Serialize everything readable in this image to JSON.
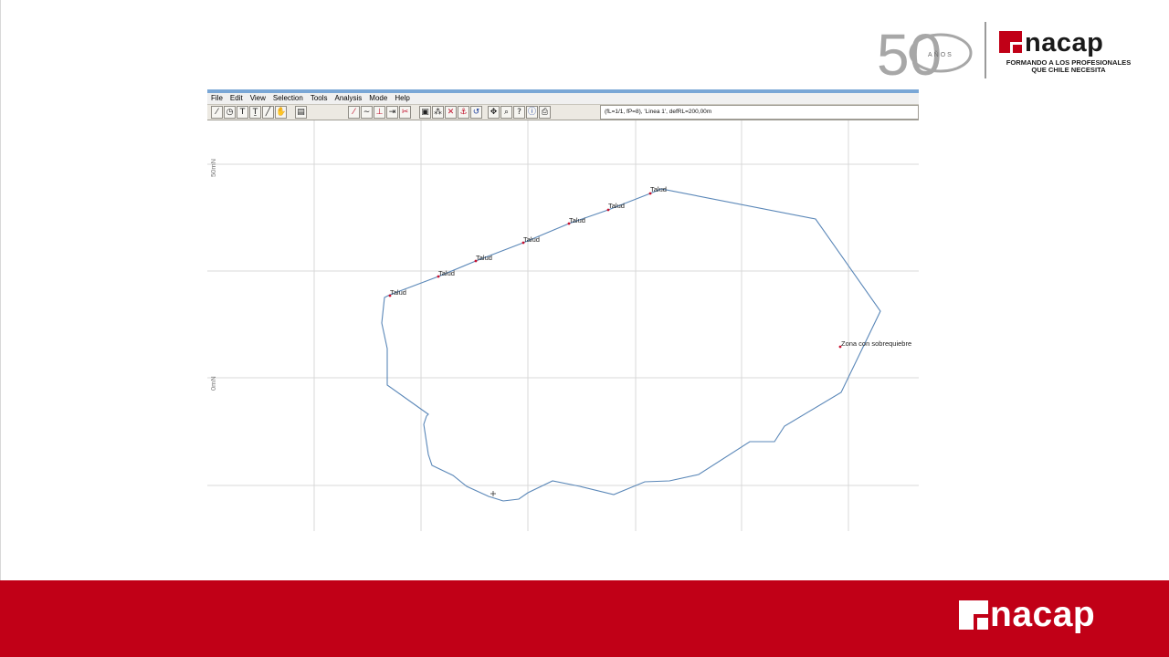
{
  "branding": {
    "anniversary_number": "50",
    "anniversary_label": "AÑOS",
    "logo_word": "nacap",
    "tagline_line1": "FORMANDO A LOS PROFESIONALES",
    "tagline_line2": "QUE CHILE NECESITA",
    "accent_color": "#c10017"
  },
  "app": {
    "menu": [
      "File",
      "Edit",
      "View",
      "Selection",
      "Tools",
      "Analysis",
      "Mode",
      "Help"
    ],
    "status_text": "(fL=1/1, fP=8), 'Linea 1', defRL=200,00m",
    "axis_labels": {
      "upper": "50mN",
      "lower": "0mN"
    },
    "point_labels": [
      "Talud",
      "Talud",
      "Talud",
      "Talud",
      "Talud",
      "Talud",
      "Talud"
    ],
    "zone_label": "Zona con sobrequiebre",
    "line_color": "#5a87b8",
    "point_color": "#c8102e"
  },
  "footer": {
    "logo_word": "nacap"
  }
}
